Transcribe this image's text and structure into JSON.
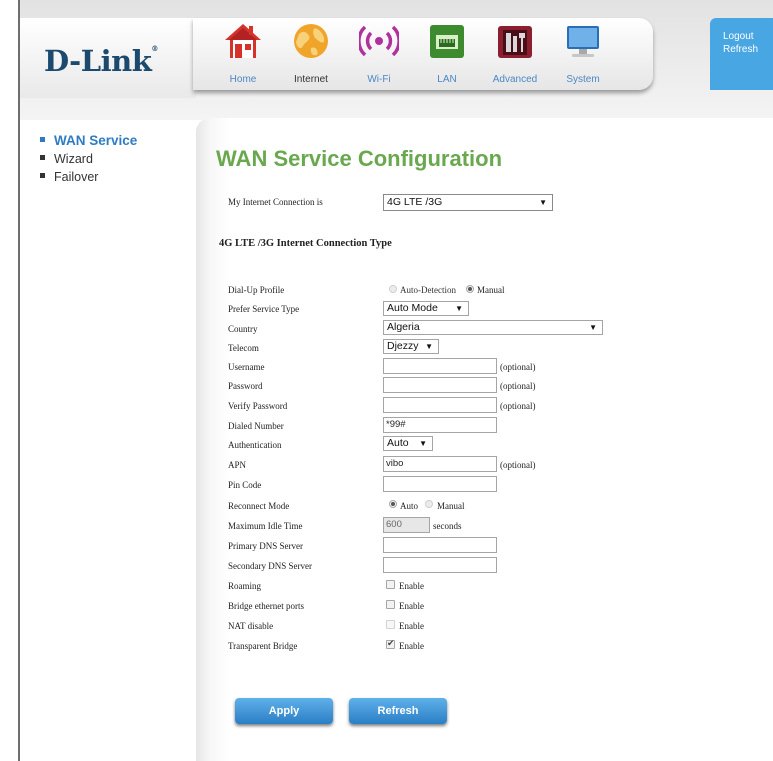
{
  "brand": {
    "logo_text": "D-Link",
    "trademark": "®"
  },
  "nav": {
    "items": [
      {
        "label": "Home",
        "icon": "home-icon"
      },
      {
        "label": "Internet",
        "icon": "globe-icon",
        "active": true
      },
      {
        "label": "Wi-Fi",
        "icon": "wifi-icon"
      },
      {
        "label": "LAN",
        "icon": "lan-port-icon"
      },
      {
        "label": "Advanced",
        "icon": "tools-icon"
      },
      {
        "label": "System",
        "icon": "monitor-icon"
      }
    ]
  },
  "user_panel": {
    "logout": "Logout",
    "refresh": "Refresh"
  },
  "sidebar": {
    "items": [
      {
        "label": "WAN Service",
        "active": true
      },
      {
        "label": "Wizard"
      },
      {
        "label": "Failover"
      }
    ]
  },
  "page": {
    "title": "WAN Service Configuration"
  },
  "connection": {
    "label": "My Internet Connection is",
    "value": "4G LTE /3G"
  },
  "section_title": "4G LTE /3G Internet Connection Type",
  "form": {
    "dialup_profile": {
      "label": "Dial-Up Profile",
      "options": [
        "Auto-Detection",
        "Manual"
      ],
      "selected": "Manual"
    },
    "prefer_service": {
      "label": "Prefer Service Type",
      "value": "Auto Mode"
    },
    "country": {
      "label": "Country",
      "value": "Algeria"
    },
    "telecom": {
      "label": "Telecom",
      "value": "Djezzy"
    },
    "username": {
      "label": "Username",
      "value": "",
      "note": "(optional)"
    },
    "password": {
      "label": "Password",
      "value": "",
      "note": "(optional)"
    },
    "verify_password": {
      "label": "Verify Password",
      "value": "",
      "note": "(optional)"
    },
    "dialed_number": {
      "label": "Dialed Number",
      "value": "*99#"
    },
    "authentication": {
      "label": "Authentication",
      "value": "Auto"
    },
    "apn": {
      "label": "APN",
      "value": "vibo",
      "note": "(optional)"
    },
    "pin_code": {
      "label": "Pin Code",
      "value": ""
    },
    "reconnect_mode": {
      "label": "Reconnect Mode",
      "options": [
        "Auto",
        "Manual"
      ],
      "selected": "Auto"
    },
    "max_idle": {
      "label": "Maximum Idle Time",
      "value": "600",
      "unit": "seconds"
    },
    "primary_dns": {
      "label": "Primary DNS Server",
      "value": ""
    },
    "secondary_dns": {
      "label": "Secondary DNS Server",
      "value": ""
    },
    "roaming": {
      "label": "Roaming",
      "option": "Enable",
      "checked": false
    },
    "bridge_ports": {
      "label": "Bridge ethernet ports",
      "option": "Enable",
      "checked": false
    },
    "nat_disable": {
      "label": "NAT disable",
      "option": "Enable",
      "checked": false
    },
    "transparent_bridge": {
      "label": "Transparent Bridge",
      "option": "Enable",
      "checked": true
    }
  },
  "buttons": {
    "apply": "Apply",
    "refresh": "Refresh"
  },
  "colors": {
    "brand_blue": "#1c4a6e",
    "nav_label": "#4b88c4",
    "accent_blue": "#2d7cc3",
    "title_green": "#6aa84f",
    "button_blue": "#2a7ec4"
  }
}
